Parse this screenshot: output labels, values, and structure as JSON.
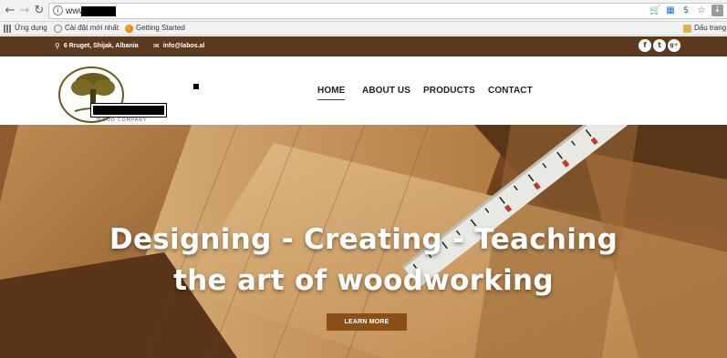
{
  "browser": {
    "url_text": "www.",
    "nav": {
      "back": "←",
      "forward": "→",
      "reload": "↻"
    },
    "omnibox_icons": [
      "shopping-cart-icon",
      "grid-icon",
      "money-icon",
      "star-icon",
      "download-icon"
    ],
    "bookmarks": [
      {
        "label": "Ứng dụng",
        "icon": "apps-icon"
      },
      {
        "label": "Cài đặt mới nhất",
        "icon": "cdn-icon"
      },
      {
        "label": "Getting Started",
        "icon": "firefox-icon"
      },
      {
        "label": "Dấu trang",
        "icon": "folder-icon"
      }
    ]
  },
  "topbar": {
    "address": "6 Rruget, Shijak, Albania",
    "email": "info@labos.al",
    "socials": [
      "f",
      "t",
      "g+"
    ]
  },
  "header": {
    "logo_caption": "WOOD COMPANY",
    "nav": [
      {
        "label": "HOME",
        "active": true
      },
      {
        "label": "ABOUT US",
        "active": false
      },
      {
        "label": "PRODUCTS",
        "active": false
      },
      {
        "label": "CONTACT",
        "active": false
      }
    ]
  },
  "hero": {
    "line1": "Designing - Creating - Teaching",
    "line2": "the art of woodworking",
    "cta": "LEARN MORE"
  },
  "colors": {
    "brand_brown": "#5b3a1f",
    "cta_brown": "#8a4f16"
  }
}
